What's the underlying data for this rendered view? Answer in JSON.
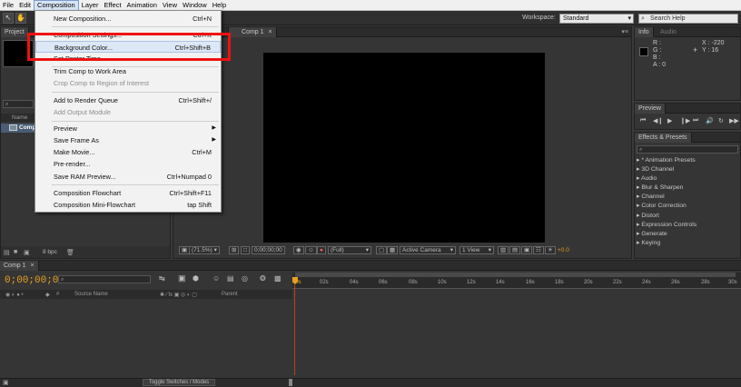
{
  "menubar": {
    "items": [
      "File",
      "Edit",
      "Composition",
      "Layer",
      "Effect",
      "Animation",
      "View",
      "Window",
      "Help"
    ]
  },
  "toolbar": {
    "workspace_label": "Workspace:",
    "workspace_value": "Standard",
    "search_placeholder": "Search Help"
  },
  "project_panel": {
    "tab": "Project",
    "column_name": "Name",
    "item_name": "Comp",
    "bpc": "8 bpc"
  },
  "dropdown": {
    "items": [
      {
        "label": "New Composition...",
        "shortcut": "Ctrl+N"
      },
      {
        "label": "Composition Settings...",
        "shortcut": "Ctrl+K"
      },
      {
        "label": "Background Color...",
        "shortcut": "Ctrl+Shift+B"
      },
      {
        "label": "Set Poster Time",
        "shortcut": ""
      },
      {
        "label": "Trim Comp to Work Area",
        "shortcut": ""
      },
      {
        "label": "Crop Comp to Region of Interest",
        "shortcut": ""
      },
      {
        "label": "Add to Render Queue",
        "shortcut": "Ctrl+Shift+/"
      },
      {
        "label": "Add Output Module",
        "shortcut": ""
      },
      {
        "label": "Preview",
        "shortcut": ""
      },
      {
        "label": "Save Frame As",
        "shortcut": ""
      },
      {
        "label": "Make Movie...",
        "shortcut": "Ctrl+M"
      },
      {
        "label": "Pre-render...",
        "shortcut": ""
      },
      {
        "label": "Save RAM Preview...",
        "shortcut": "Ctrl+Numpad 0"
      },
      {
        "label": "Composition Flowchart",
        "shortcut": "Ctrl+Shift+F11"
      },
      {
        "label": "Composition Mini-Flowchart",
        "shortcut": "tap Shift"
      }
    ]
  },
  "viewer": {
    "tab": "Comp 1",
    "zoom": "(71.5%)",
    "timecode": "0;00;00;00",
    "resolution": "(Full)",
    "camera": "Active Camera",
    "view": "1 View",
    "exposure": "+0.0"
  },
  "info_panel": {
    "tabs": [
      "Info",
      "Audio"
    ],
    "r": "R :",
    "g": "G :",
    "b": "B :",
    "a": "A : 0",
    "x": "X : -220",
    "y": "Y : 16"
  },
  "preview_panel": {
    "tab": "Preview"
  },
  "effects_panel": {
    "tab": "Effects & Presets",
    "items": [
      "* Animation Presets",
      "3D Channel",
      "Audio",
      "Blur & Sharpen",
      "Channel",
      "Color Correction",
      "Distort",
      "Expression Controls",
      "Generate",
      "Keying"
    ]
  },
  "timeline": {
    "tab": "Comp 1",
    "timecode": "0;00;00;00",
    "ruler": [
      "00s",
      "02s",
      "04s",
      "06s",
      "08s",
      "10s",
      "12s",
      "14s",
      "16s",
      "18s",
      "20s",
      "22s",
      "24s",
      "26s",
      "28s",
      "30s"
    ],
    "col_source": "Source Name",
    "col_parent": "Parent",
    "toggle_label": "Toggle Switches / Modes"
  }
}
